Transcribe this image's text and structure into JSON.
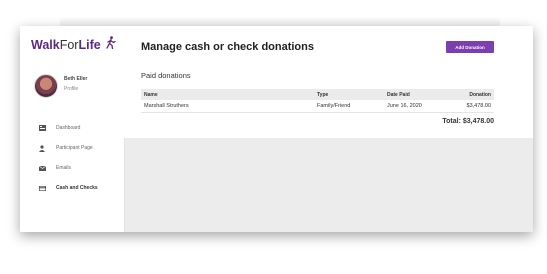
{
  "app": {
    "logo_walk": "Walk",
    "logo_for": "For",
    "logo_life": "Life"
  },
  "user": {
    "name": "Beth Eller",
    "profile": "Profile"
  },
  "sidebar": {
    "items": [
      {
        "label": "Dashboard",
        "icon": "dashboard-icon"
      },
      {
        "label": "Participant Page",
        "icon": "person-icon"
      },
      {
        "label": "Emails",
        "icon": "mail-icon"
      },
      {
        "label": "Cash and Checks",
        "icon": "credit-card-icon",
        "active": true
      }
    ]
  },
  "main": {
    "title": "Manage cash or check donations",
    "add_button": "Add Donation",
    "section_title": "Paid donations",
    "table": {
      "headers": [
        "Name",
        "Type",
        "Date Paid",
        "Donation"
      ],
      "rows": [
        [
          "Marshall Struthers",
          "Family/Friend",
          "June 16, 2020",
          "$3,478.00"
        ]
      ]
    },
    "total": "Total: $3,478.00"
  },
  "colors": {
    "brand": "#5a2a82",
    "button": "#7b3fb0",
    "background": "#ececec"
  }
}
